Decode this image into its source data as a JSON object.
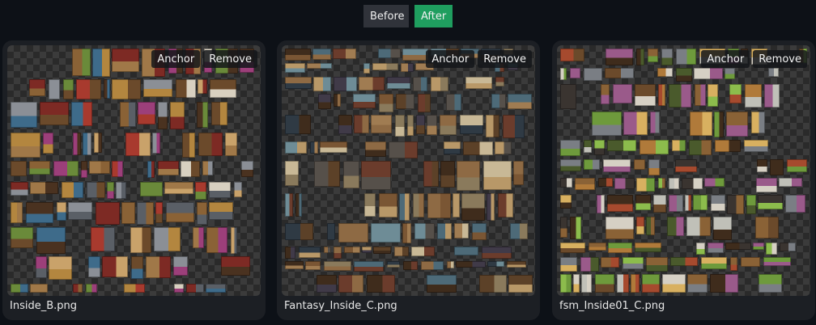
{
  "toggle": {
    "before_label": "Before",
    "after_label": "After"
  },
  "cards": [
    {
      "filename": "Inside_B.png",
      "anchor_label": "Anchor",
      "remove_label": "Remove"
    },
    {
      "filename": "Fantasy_Inside_C.png",
      "anchor_label": "Anchor",
      "remove_label": "Remove"
    },
    {
      "filename": "fsm_Inside01_C.png",
      "anchor_label": "Anchor",
      "remove_label": "Remove"
    }
  ],
  "colors": {
    "page_bg": "#0d1117",
    "card_bg": "#1c1f24",
    "active_toggle": "#1f9e5f",
    "inactive_toggle": "#30333a"
  }
}
